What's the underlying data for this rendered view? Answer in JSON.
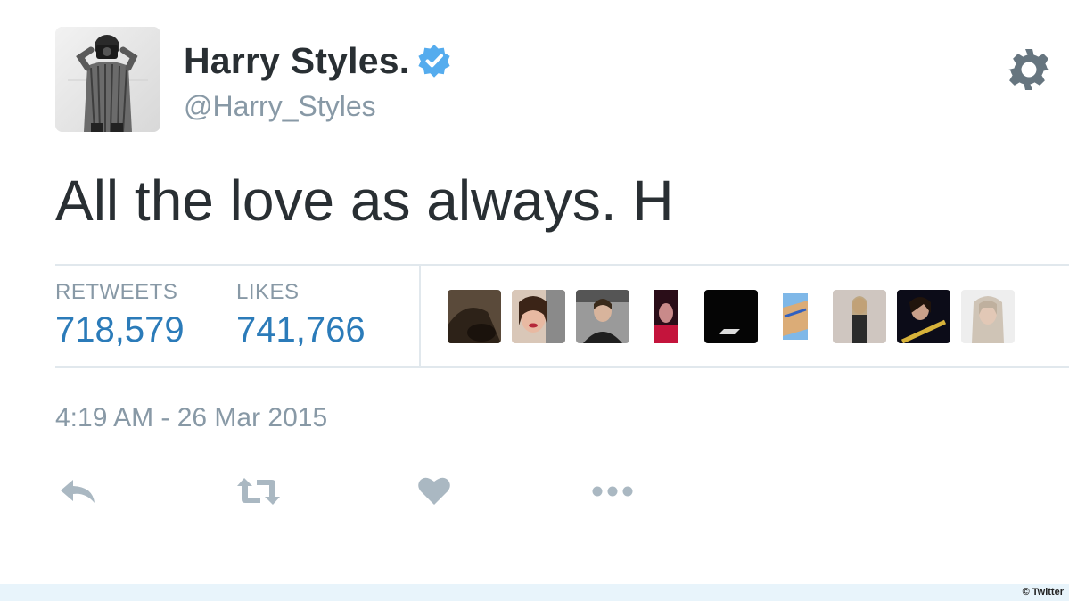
{
  "user": {
    "display_name": "Harry Styles.",
    "handle": "@Harry_Styles",
    "verified_icon": "verified-badge-icon"
  },
  "tweet": {
    "text": "All the love as always. H",
    "timestamp": "4:19 AM - 26 Mar 2015"
  },
  "stats": {
    "retweets_label": "RETWEETS",
    "retweets_value": "718,579",
    "likes_label": "LIKES",
    "likes_value": "741,766"
  },
  "likers_count_shown": 9,
  "actions": [
    "reply-icon",
    "retweet-icon",
    "like-icon",
    "more-icon"
  ],
  "credit": "© Twitter",
  "colors": {
    "text": "#292f33",
    "muted": "#8899a6",
    "stat_value": "#2b7bb9",
    "verified": "#1da1f2",
    "divider": "#e1e8ed",
    "action_icon": "#aab8c2"
  }
}
